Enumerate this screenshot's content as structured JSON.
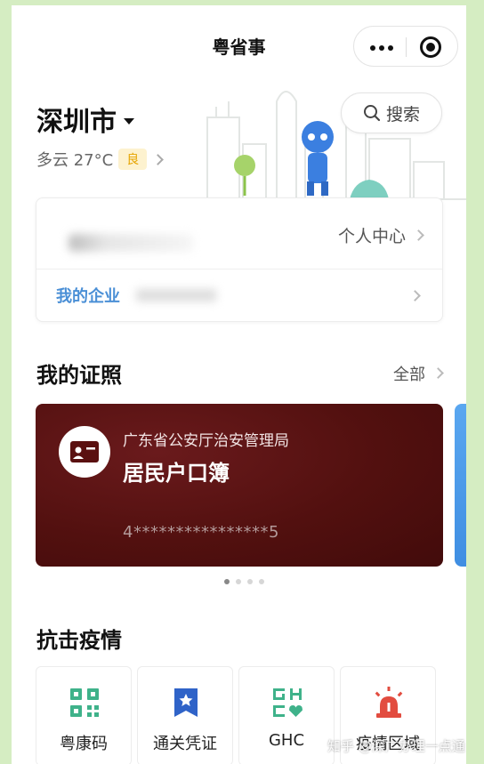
{
  "app": {
    "title": "粤省事"
  },
  "header": {
    "city": "深圳市",
    "weather": "多云 27°C",
    "aqi": "良",
    "search_label": "搜索"
  },
  "profile": {
    "personal_center": "个人中心",
    "my_company": "我的企业"
  },
  "certificates": {
    "title": "我的证照",
    "more": "全部",
    "card": {
      "issuer": "广东省公安厅治安管理局",
      "name": "居民户口簿",
      "number": "4****************5"
    },
    "page_count": 4,
    "active_page": 1
  },
  "epidemic": {
    "title": "抗击疫情",
    "services": [
      {
        "label": "粤康码",
        "icon": "qr-code-icon"
      },
      {
        "label": "通关凭证",
        "icon": "star-badge-icon"
      },
      {
        "label": "GHC",
        "icon": "ghc-heart-icon"
      },
      {
        "label": "疫情区域",
        "icon": "alarm-siren-icon"
      }
    ]
  },
  "watermark": "知乎 @深广办理一点通",
  "colors": {
    "accent_blue": "#4a8fd6",
    "card_maroon": "#52100f",
    "icon_green": "#3fb28a",
    "icon_blue": "#2f63c8",
    "icon_red": "#e24c3f",
    "aqi_yellow": "#e6a400"
  }
}
